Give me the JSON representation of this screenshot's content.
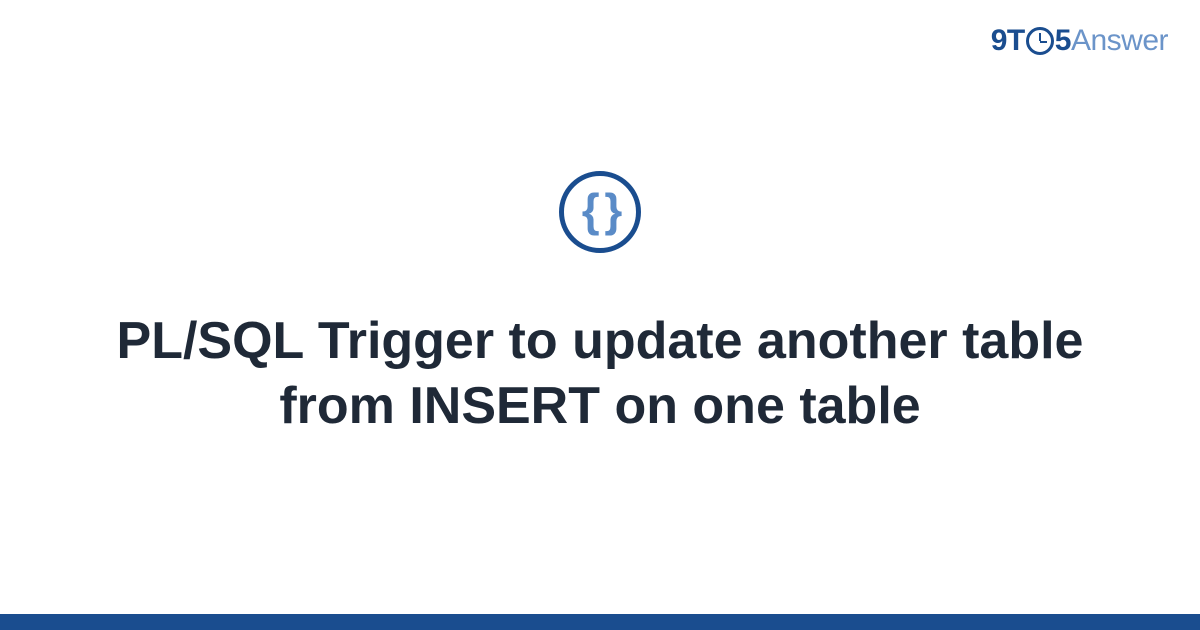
{
  "logo": {
    "part1": "9T",
    "part2": "5",
    "part3": "Answer"
  },
  "icon": {
    "name": "code-braces-icon",
    "glyph": "{ }"
  },
  "title": "PL/SQL Trigger to update another table from INSERT on one table",
  "colors": {
    "primary": "#1a4d8f",
    "secondary": "#6b94c9",
    "text": "#1f2937"
  }
}
